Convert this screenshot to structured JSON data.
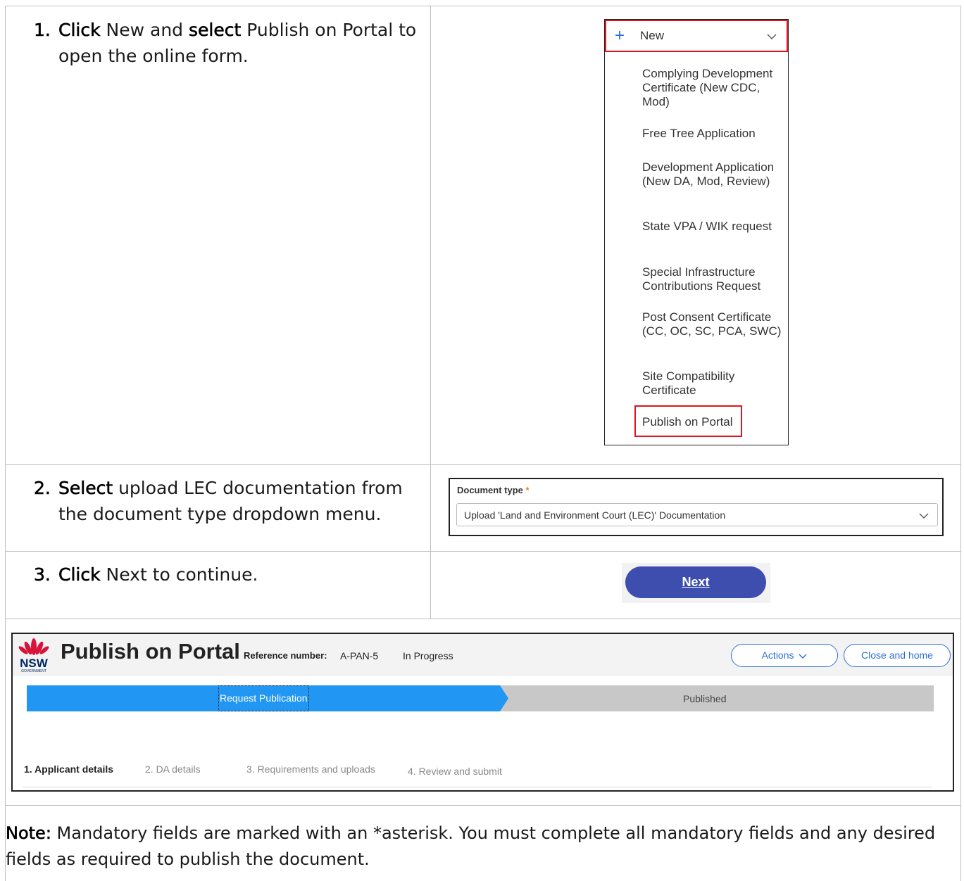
{
  "steps": [
    {
      "number": "1.",
      "action": "Click",
      "text_a": " New and ",
      "action2": "select",
      "text_b": " Publish on Portal to",
      "text_c": "open the online form."
    },
    {
      "number": "2.",
      "action": "Select",
      "text_a": " upload LEC documentation from",
      "text_c": "the document type dropdown menu."
    },
    {
      "number": "3.",
      "action": "Click",
      "text_a": " Next to continue."
    }
  ],
  "new_menu": {
    "new_label": "New",
    "items": [
      {
        "label": "Complying Development Certificate (New CDC, Mod)"
      },
      {
        "label": "Free Tree Application"
      },
      {
        "label": "Development Application (New DA, Mod, Review)"
      },
      {
        "label": "State VPA / WIK request"
      },
      {
        "label": "Special Infrastructure Contributions Request"
      },
      {
        "label": "Post Consent Certificate (CC, OC, SC, PCA, SWC)"
      },
      {
        "label": "Site Compatibility Certificate"
      }
    ],
    "publish_label": "Publish on Portal"
  },
  "document_type": {
    "label": "Document type",
    "required_mark": "*",
    "selected": "Upload 'Land and Environment Court (LEC)' Documentation"
  },
  "next_button": {
    "label": "Next"
  },
  "portal": {
    "logo_text": "NSW",
    "logo_subtext": "GOVERNMENT",
    "title": "Publish on Portal",
    "reference_label": "Reference number:",
    "reference_value": "A-PAN-5",
    "status": "In Progress",
    "actions_label": "Actions",
    "close_label": "Close and home",
    "progress": {
      "current": "Request Publication",
      "next": "Published"
    },
    "tabs": [
      {
        "label": "1. Applicant details"
      },
      {
        "label": "2. DA details"
      },
      {
        "label": "3. Requirements and uploads"
      },
      {
        "label": "4. Review and submit"
      }
    ]
  },
  "note": {
    "lead": "Note:",
    "text": " Mandatory fields are marked with an *asterisk. You must complete all mandatory fields and any desired fields as required to publish the document."
  },
  "colors": {
    "highlight_red": "#e0141e",
    "next_button": "#3d4eaf",
    "progress_active": "#2196f3",
    "progress_inactive": "#c8c8c8",
    "link_blue": "#2d6fd1",
    "required_star": "#e8870e"
  }
}
